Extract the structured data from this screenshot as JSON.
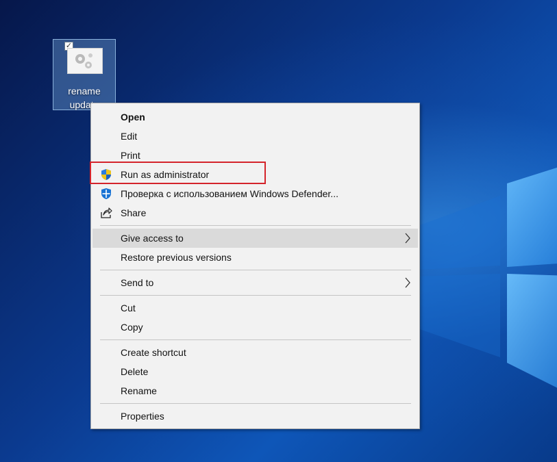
{
  "desktop": {
    "icon": {
      "label_line1": "rename",
      "label_line2": "update",
      "checkbox": "✓"
    }
  },
  "menu": {
    "items": [
      {
        "label": "Open",
        "bold": true
      },
      {
        "label": "Edit"
      },
      {
        "label": "Print"
      },
      {
        "label": "Run as administrator",
        "icon": "uac-shield-icon"
      },
      {
        "label": "Проверка с использованием Windows Defender...",
        "icon": "defender-icon"
      },
      {
        "label": "Share",
        "icon": "share-icon"
      },
      {
        "label": "Give access to",
        "submenu": true
      },
      {
        "label": "Restore previous versions"
      },
      {
        "label": "Send to",
        "submenu": true
      },
      {
        "label": "Cut"
      },
      {
        "label": "Copy"
      },
      {
        "label": "Create shortcut"
      },
      {
        "label": "Delete"
      },
      {
        "label": "Rename"
      },
      {
        "label": "Properties"
      }
    ]
  },
  "colors": {
    "highlight": "#d4232a",
    "hover_bg": "#dadada",
    "menu_bg": "#f2f2f2"
  }
}
